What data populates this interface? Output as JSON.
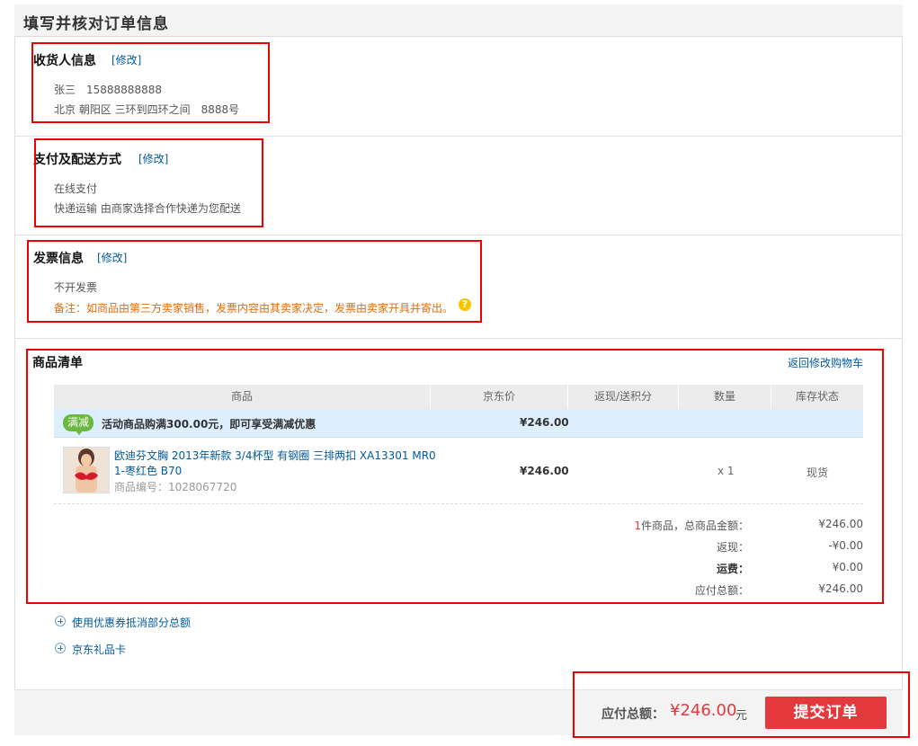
{
  "page": {
    "title": "填写并核对订单信息"
  },
  "consignee": {
    "title": "收货人信息",
    "edit": "[修改]",
    "name_phone": "张三　15888888888",
    "address": "北京 朝阳区 三环到四环之间　8888号"
  },
  "payment": {
    "title": "支付及配送方式",
    "edit": "[修改]",
    "method": "在线支付",
    "shipping": "快递运输  由商家选择合作快递为您配送"
  },
  "invoice": {
    "title": "发票信息",
    "edit": "[修改]",
    "value": "不开发票",
    "note": "备注：如商品由第三方卖家销售，发票内容由其卖家决定，发票由卖家开具并寄出。",
    "help_icon": "?"
  },
  "items": {
    "title": "商品清单",
    "back_link": "返回修改购物车",
    "columns": [
      "商品",
      "京东价",
      "返现/送积分",
      "数量",
      "库存状态"
    ],
    "promo": {
      "badge": "满减",
      "text": "活动商品购满300.00元，即可享受满减优惠",
      "price": "¥246.00"
    },
    "rows": [
      {
        "name_line1": "欧迪芬文胸 2013年新款 3/4杯型 有钢圈 三排两扣 XA13301 MR0",
        "name_line2": "1-枣红色 B70",
        "sku": "商品编号：1028067720",
        "price": "¥246.00",
        "qty": "x 1",
        "stock": "现货"
      }
    ],
    "summary": {
      "count": "1",
      "count_label": "件商品，总商品金额：",
      "goods_total": "¥246.00",
      "rebate_label": "返现：",
      "rebate": "-¥0.00",
      "freight_label": "运费：",
      "freight": "¥0.00",
      "payable_label": "应付总额：",
      "payable": "¥246.00"
    }
  },
  "extras": {
    "coupon": "使用优惠券抵消部分总额",
    "gift_card": "京东礼品卡"
  },
  "footer": {
    "total_label": "应付总额：",
    "total_amount": "¥246.00",
    "total_unit": "元",
    "submit": "提交订单"
  },
  "colors": {
    "accent_red": "#e4393c",
    "link_blue": "#005aa0",
    "badge_green": "#6ab83d"
  }
}
